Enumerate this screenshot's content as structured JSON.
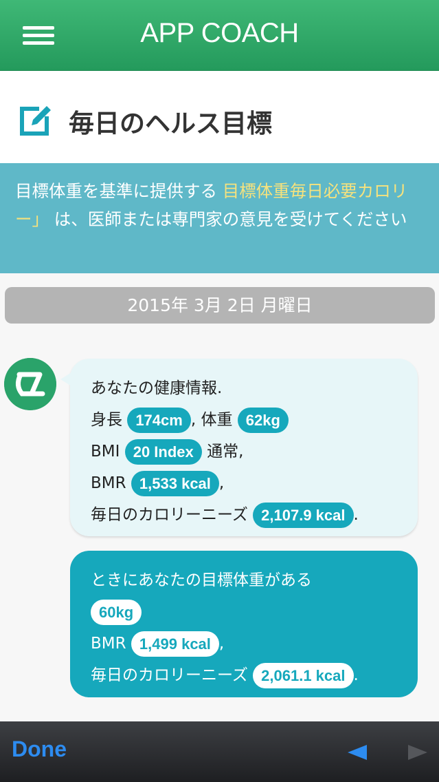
{
  "header": {
    "title": "APP COACH"
  },
  "goal": {
    "title": "毎日のヘルス目標"
  },
  "notice": {
    "text_before": "目標体重を基準に提供する",
    "highlight": "目標体重毎日必要カロリー」",
    "text_after": "は、医師または専門家の意見を受けてください"
  },
  "date": "2015年 3月 2日 月曜日",
  "current": {
    "intro": "あなたの健康情報.",
    "height_label": "身長",
    "height_value": "174cm",
    "weight_label": ", 体重",
    "weight_value": "62kg",
    "bmi_label": "BMI",
    "bmi_value": "20 Index",
    "bmi_status": "通常,",
    "bmr_label": "BMR",
    "bmr_value": "1,533 kcal",
    "comma": ",",
    "calorie_label": "毎日のカロリーニーズ",
    "calorie_value": "2,107.9 kcal",
    "period": "."
  },
  "target": {
    "intro": "ときにあなたの目標体重がある",
    "weight_value": "60kg",
    "bmr_label": "BMR",
    "bmr_value": "1,499 kcal",
    "comma": ",",
    "calorie_label": "毎日のカロリーニーズ",
    "calorie_value": "2,061.1 kcal",
    "period": "."
  },
  "toolbar": {
    "done_label": "Done"
  },
  "colors": {
    "header_green": "#2ba565",
    "notice_blue": "#5fb8c8",
    "accent_teal": "#16a8bc",
    "highlight_yellow": "#f6e27d",
    "done_blue": "#2d8cf0"
  },
  "icons": [
    "menu-icon",
    "edit-icon",
    "coach-avatar-icon",
    "prev-arrow-icon",
    "next-arrow-icon"
  ]
}
